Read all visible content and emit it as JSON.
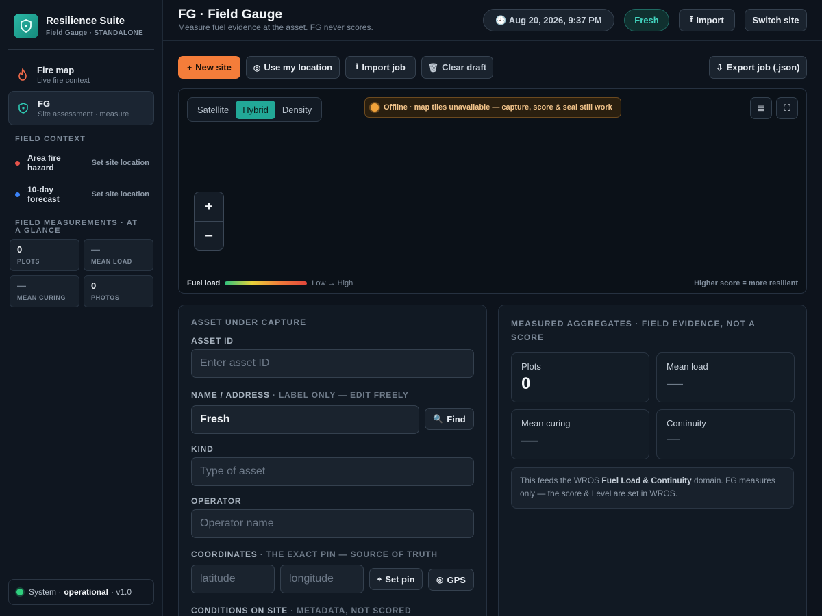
{
  "brand": {
    "title": "Resilience Suite",
    "subtitle": "Field Gauge · STANDALONE"
  },
  "nav": [
    {
      "title": "Fire map",
      "subtitle": "Live fire context",
      "icon": "flame-icon",
      "active": false
    },
    {
      "title": "FG",
      "subtitle": "Site assessment · measure",
      "icon": "shield-icon",
      "active": true
    }
  ],
  "field_context": {
    "title": "FIELD CONTEXT",
    "items": [
      {
        "label": "Area fire hazard",
        "action": "Set site location",
        "color": "#e5534b"
      },
      {
        "label": "10-day forecast",
        "action": "Set site location",
        "color": "#3b82f6"
      }
    ]
  },
  "measurements": {
    "title": "FIELD MEASUREMENTS · AT A GLANCE",
    "stats": [
      {
        "value": "0",
        "label": "PLOTS"
      },
      {
        "value": "—",
        "label": "MEAN LOAD"
      },
      {
        "value": "—",
        "label": "MEAN CURING"
      },
      {
        "value": "0",
        "label": "PHOTOS"
      }
    ]
  },
  "system": {
    "prefix": "System ·",
    "status": "operational",
    "version": "· v1.0"
  },
  "header": {
    "title": "FG · Field Gauge",
    "subtitle": "Measure fuel evidence at the asset. FG never scores.",
    "clock": "🕘 Aug 20, 2026, 9:37 PM",
    "freshness": "Fresh",
    "import": "Import",
    "switch_site": "Switch site"
  },
  "toolbar": {
    "new_site": "New site",
    "use_location": "Use my location",
    "import_job": "Import job",
    "clear_draft": "Clear draft",
    "export_job": "Export job (.json)"
  },
  "map": {
    "layers": [
      "Satellite",
      "Hybrid",
      "Density"
    ],
    "active_layer": "Hybrid",
    "offline_notice": "Offline · map tiles unavailable — capture, score & seal still work",
    "legend_label": "Fuel load",
    "legend_range": "Low → High",
    "note": "Higher score = more resilient",
    "zoom_in": "+",
    "zoom_out": "−"
  },
  "asset": {
    "section_title": "ASSET UNDER CAPTURE",
    "asset_id_label": "ASSET ID",
    "asset_id_placeholder": "Enter asset ID",
    "name_label": "NAME / ADDRESS",
    "name_hint": "· LABEL ONLY — EDIT FREELY",
    "name_value": "Fresh",
    "find": "Find",
    "kind_label": "KIND",
    "kind_placeholder": "Type of asset",
    "operator_label": "OPERATOR",
    "operator_placeholder": "Operator name",
    "coords_label": "COORDINATES",
    "coords_hint": "· THE EXACT PIN — SOURCE OF TRUTH",
    "lat_placeholder": "latitude",
    "lon_placeholder": "longitude",
    "set_pin": "Set pin",
    "gps": "GPS",
    "conditions_label": "CONDITIONS ON SITE",
    "conditions_hint": "· METADATA, NOT SCORED"
  },
  "aggregates": {
    "title": "MEASURED AGGREGATES · FIELD EVIDENCE, NOT A SCORE",
    "cards": [
      {
        "label": "Plots",
        "value": "0"
      },
      {
        "label": "Mean load",
        "value": "—"
      },
      {
        "label": "Mean curing",
        "value": "—"
      },
      {
        "label": "Continuity",
        "value": "—"
      }
    ],
    "note_pre": "This feeds the WROS ",
    "note_bold": "Fuel Load & Continuity",
    "note_post": " domain. FG measures only — the score & Level are set in WROS."
  },
  "colors": {
    "accent": "#22a897",
    "primary": "#f47d3a",
    "status_ok": "#2fcf7e"
  }
}
